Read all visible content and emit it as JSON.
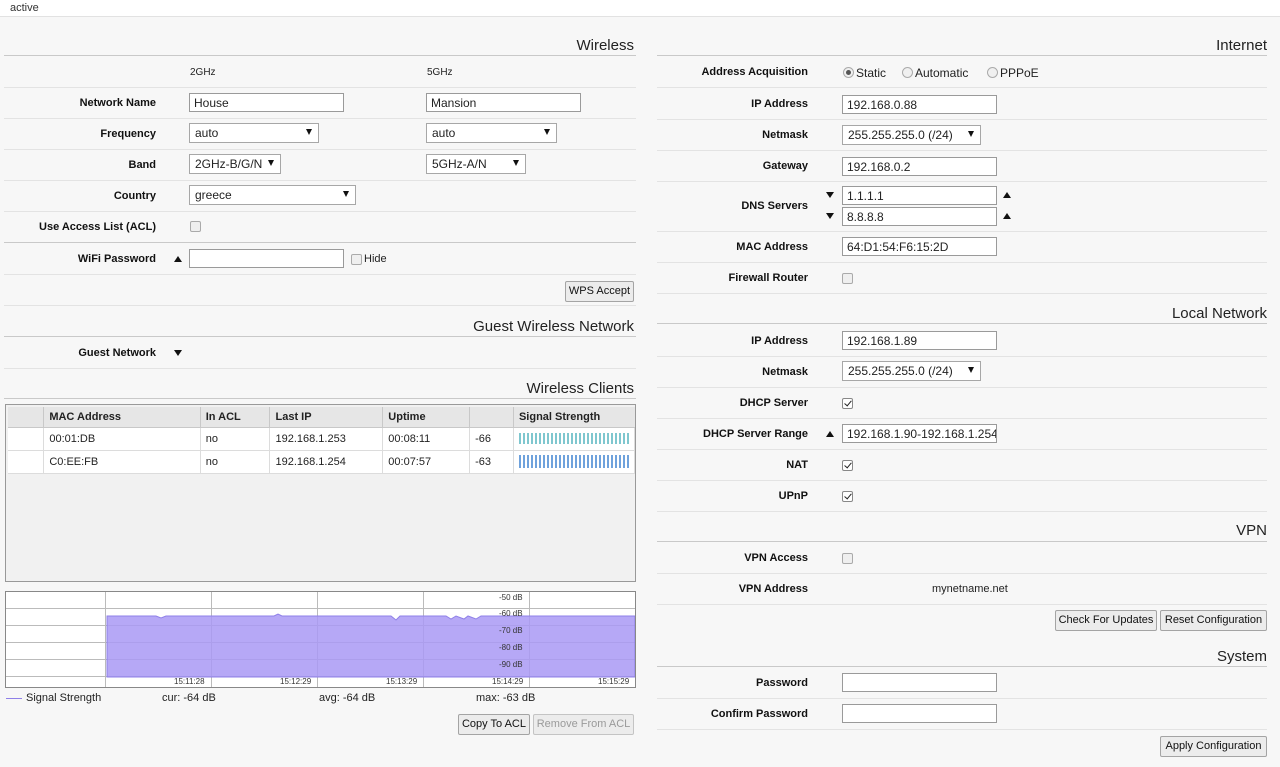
{
  "status": "active",
  "wireless": {
    "title": "Wireless",
    "col_2ghz": "2GHz",
    "col_5ghz": "5GHz",
    "network_name_label": "Network Name",
    "network_name_2": "House",
    "network_name_5": "Mansion",
    "frequency_label": "Frequency",
    "frequency_2": "auto",
    "frequency_5": "auto",
    "band_label": "Band",
    "band_2": "2GHz-B/G/N",
    "band_5": "5GHz-A/N",
    "country_label": "Country",
    "country": "greece",
    "acl_label": "Use Access List (ACL)",
    "password_label": "WiFi Password",
    "password": "",
    "hide_label": "Hide",
    "wps_button": "WPS Accept"
  },
  "guest": {
    "title": "Guest Wireless Network",
    "network_label": "Guest Network"
  },
  "clients": {
    "title": "Wireless Clients",
    "headers": [
      "MAC Address",
      "In ACL",
      "Last IP",
      "Uptime",
      "",
      "Signal Strength"
    ],
    "rows": [
      {
        "mac": "00:01:DB",
        "acl": "no",
        "ip": "192.168.1.253",
        "uptime": "00:08:11",
        "signal": "-66"
      },
      {
        "mac": "C0:EE:FB",
        "acl": "no",
        "ip": "192.168.1.254",
        "uptime": "00:07:57",
        "signal": "-63"
      }
    ],
    "graph": {
      "y_labels": [
        "-50 dB",
        "-60 dB",
        "-70 dB",
        "-80 dB",
        "-90 dB"
      ],
      "x_labels": [
        "15:11:28",
        "15:12:29",
        "15:13:29",
        "15:14:29",
        "15:15:29"
      ],
      "legend": "Signal Strength",
      "cur": "cur: -64 dB",
      "avg": "avg: -64 dB",
      "max": "max: -63 dB",
      "fill_color": "#a999f5",
      "line_color": "#8f80e8"
    },
    "copy_button": "Copy To ACL",
    "remove_button": "Remove From ACL"
  },
  "internet": {
    "title": "Internet",
    "acq_label": "Address Acquisition",
    "acq_options": [
      "Static",
      "Automatic",
      "PPPoE"
    ],
    "acq_selected": "Static",
    "ip_label": "IP Address",
    "ip": "192.168.0.88",
    "netmask_label": "Netmask",
    "netmask": "255.255.255.0 (/24)",
    "gateway_label": "Gateway",
    "gateway": "192.168.0.2",
    "dns_label": "DNS Servers",
    "dns1": "1.1.1.1",
    "dns2": "8.8.8.8",
    "mac_label": "MAC Address",
    "mac": "64:D1:54:F6:15:2D",
    "firewall_label": "Firewall Router"
  },
  "local": {
    "title": "Local Network",
    "ip_label": "IP Address",
    "ip": "192.168.1.89",
    "netmask_label": "Netmask",
    "netmask": "255.255.255.0 (/24)",
    "dhcp_label": "DHCP Server",
    "range_label": "DHCP Server Range",
    "range": "192.168.1.90-192.168.1.254",
    "nat_label": "NAT",
    "upnp_label": "UPnP"
  },
  "vpn": {
    "title": "VPN",
    "access_label": "VPN Access",
    "address_label": "VPN Address",
    "address": "mynetname.net",
    "check_button": "Check For Updates",
    "reset_button": "Reset Configuration"
  },
  "system": {
    "title": "System",
    "password_label": "Password",
    "confirm_label": "Confirm Password",
    "apply_button": "Apply Configuration"
  }
}
